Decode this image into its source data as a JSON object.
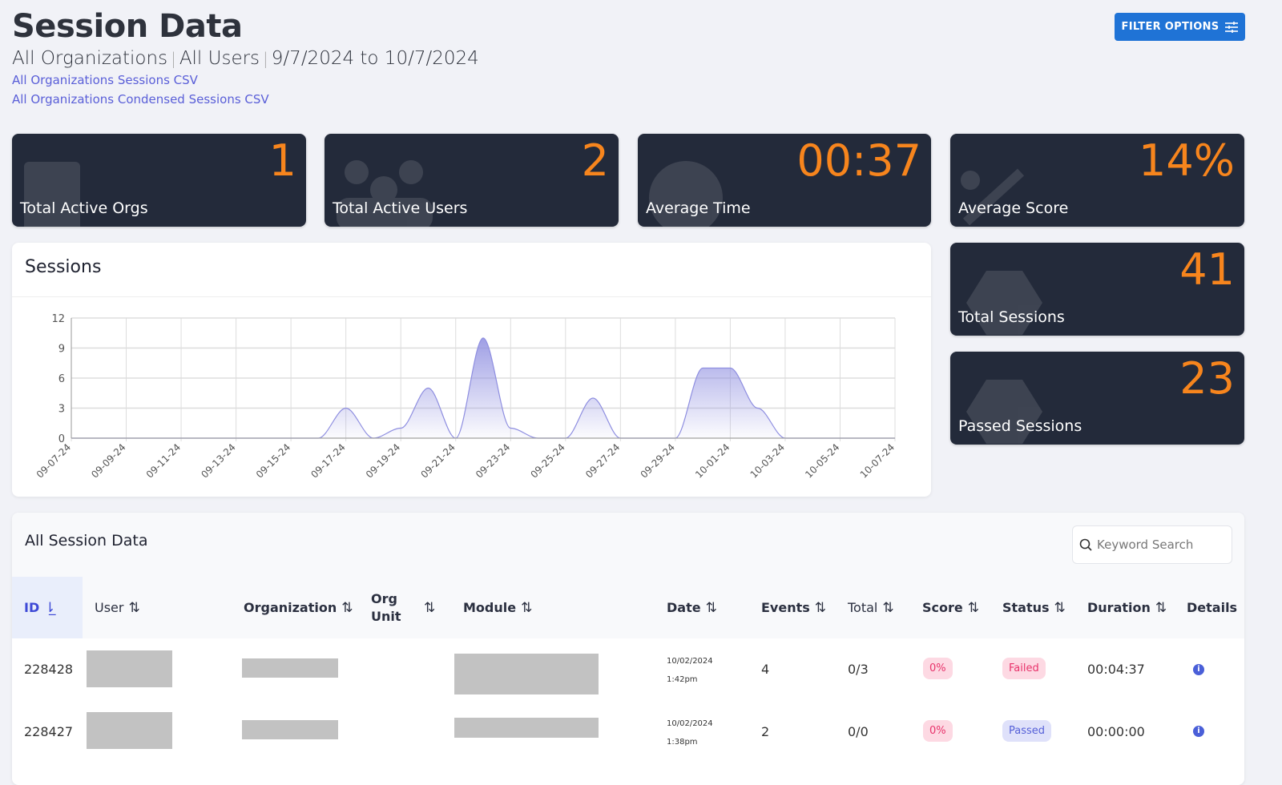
{
  "header": {
    "title": "Session Data",
    "org": "All Organizations",
    "users": "All Users",
    "range": "9/7/2024 to 10/7/2024",
    "link1": "All Organizations Sessions CSV",
    "link2": "All Organizations Condensed Sessions CSV",
    "filter_label": "FILTER OPTIONS"
  },
  "stats": [
    {
      "value": "1",
      "label": "Total Active Orgs",
      "icon": "building-icon"
    },
    {
      "value": "2",
      "label": "Total Active Users",
      "icon": "users-icon"
    },
    {
      "value": "00:37",
      "label": "Average Time",
      "icon": "clock-icon"
    },
    {
      "value": "14%",
      "label": "Average Score",
      "icon": "percent-icon"
    },
    {
      "value": "41",
      "label": "Total Sessions",
      "icon": "hexagon-icon"
    },
    {
      "value": "23",
      "label": "Passed Sessions",
      "icon": "hexagon-icon"
    }
  ],
  "chart_data": {
    "type": "area",
    "title": "Sessions",
    "ylim": [
      0,
      12
    ],
    "yticks": [
      0,
      3,
      6,
      9,
      12
    ],
    "x": [
      "09-07-24",
      "09-08-24",
      "09-09-24",
      "09-10-24",
      "09-11-24",
      "09-12-24",
      "09-13-24",
      "09-14-24",
      "09-15-24",
      "09-16-24",
      "09-17-24",
      "09-18-24",
      "09-19-24",
      "09-20-24",
      "09-21-24",
      "09-22-24",
      "09-23-24",
      "09-24-24",
      "09-25-24",
      "09-26-24",
      "09-27-24",
      "09-28-24",
      "09-29-24",
      "09-30-24",
      "10-01-24",
      "10-02-24",
      "10-03-24",
      "10-04-24",
      "10-05-24",
      "10-06-24",
      "10-07-24"
    ],
    "values": [
      0,
      0,
      0,
      0,
      0,
      0,
      0,
      0,
      0,
      0,
      3,
      0,
      1,
      5,
      0,
      10,
      1,
      0,
      0,
      4,
      0,
      0,
      0,
      7,
      7,
      3,
      0,
      0,
      0,
      0,
      0
    ],
    "xtick_labels": [
      "09-07-24",
      "09-09-24",
      "09-11-24",
      "09-13-24",
      "09-15-24",
      "09-17-24",
      "09-19-24",
      "09-21-24",
      "09-23-24",
      "09-25-24",
      "09-27-24",
      "09-29-24",
      "10-01-24",
      "10-03-24",
      "10-05-24",
      "10-07-24"
    ],
    "color": "#8e8ee0"
  },
  "table": {
    "title": "All Session Data",
    "search_placeholder": "Keyword Search",
    "columns": [
      "ID",
      "User",
      "Organization",
      "Org Unit",
      "Module",
      "Date",
      "Events",
      "Total",
      "Score",
      "Status",
      "Duration",
      "Details"
    ],
    "rows": [
      {
        "id": "228428",
        "date": "10/02/2024",
        "time": "1:42pm",
        "events": "4",
        "total": "0/3",
        "score": "0%",
        "status": "Failed",
        "duration": "00:04:37"
      },
      {
        "id": "228427",
        "date": "10/02/2024",
        "time": "1:38pm",
        "events": "2",
        "total": "0/0",
        "score": "0%",
        "status": "Passed",
        "duration": "00:00:00"
      }
    ]
  }
}
